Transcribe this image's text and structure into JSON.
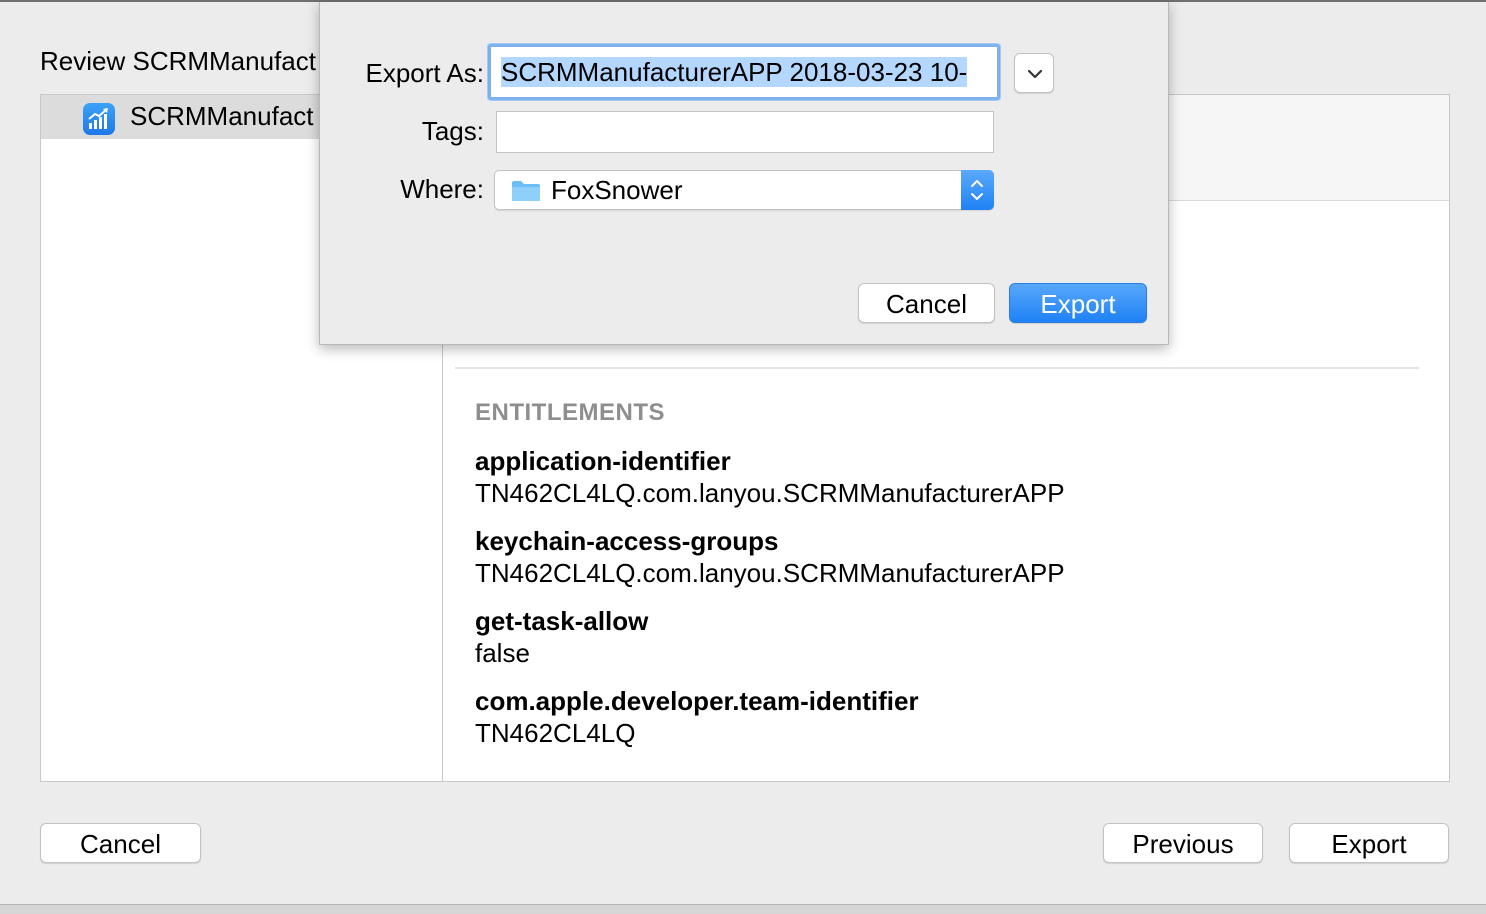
{
  "review": {
    "title": "Review SCRMManufact",
    "sidebar_item": "SCRMManufact"
  },
  "entitlements": {
    "heading": "ENTITLEMENTS",
    "items": [
      {
        "key": "application-identifier",
        "value": "TN462CL4LQ.com.lanyou.SCRMManufacturerAPP"
      },
      {
        "key": "keychain-access-groups",
        "value": "TN462CL4LQ.com.lanyou.SCRMManufacturerAPP"
      },
      {
        "key": "get-task-allow",
        "value": "false"
      },
      {
        "key": "com.apple.developer.team-identifier",
        "value": "TN462CL4LQ"
      }
    ]
  },
  "footer": {
    "cancel": "Cancel",
    "previous": "Previous",
    "export": "Export"
  },
  "sheet": {
    "export_as_label": "Export As:",
    "export_as_value": "SCRMManufacturerAPP 2018-03-23 10-",
    "tags_label": "Tags:",
    "tags_value": "",
    "where_label": "Where:",
    "where_value": "FoxSnower",
    "cancel": "Cancel",
    "export": "Export"
  },
  "icons": {
    "app": "app-chart-icon",
    "folder": "folder-icon",
    "expand": "chevron-down-icon",
    "stepper": "up-down-chevron-icon"
  },
  "colors": {
    "accent": "#1f82f5",
    "selection": "#b3d7ff",
    "focus_ring": "#7eb1ec",
    "section_heading": "#8e8e8e"
  }
}
